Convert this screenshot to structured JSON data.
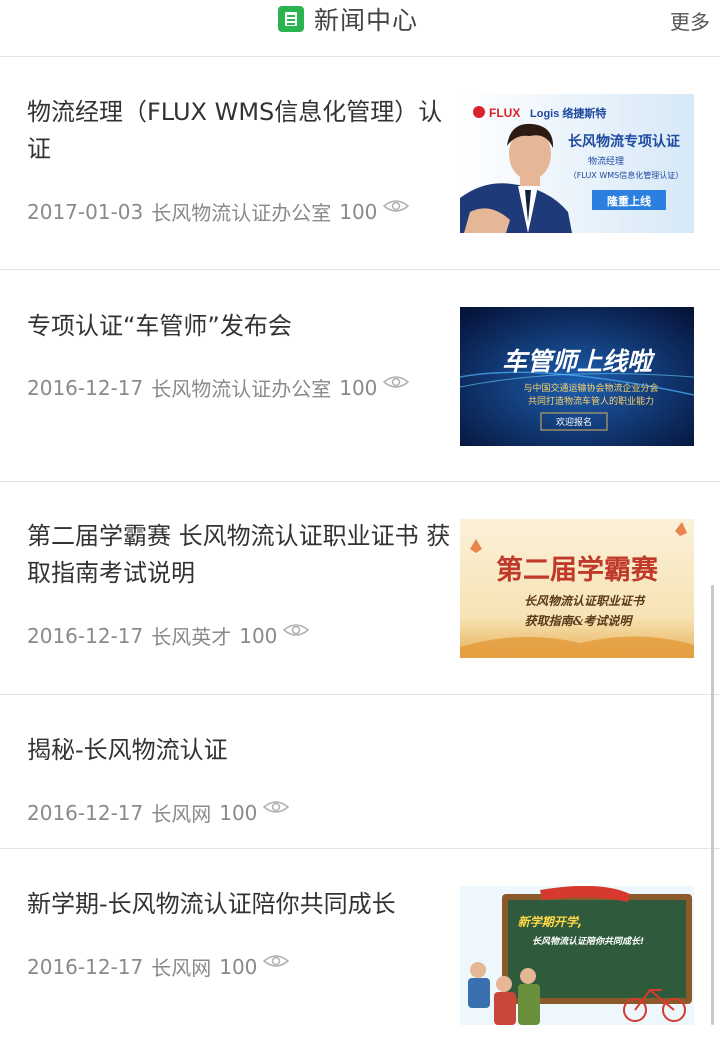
{
  "header": {
    "title": "新闻中心",
    "more_label": "更多"
  },
  "items": [
    {
      "title_line1": "物流经理（FLUX WMS信息化管理）认",
      "title_line2": "证",
      "date": "2017-01-03",
      "source": "长风物流认证办公室",
      "views": "100",
      "thumb": {
        "brand": "FLUX",
        "brand2": "Logis 络捷斯特",
        "heading": "长风物流专项认证",
        "sub1": "物流经理",
        "sub2": "（FLUX WMS信息化管理认证）",
        "badge": "隆重上线"
      }
    },
    {
      "title_line1": "专项认证“车管师”发布会",
      "title_line2": "",
      "date": "2016-12-17",
      "source": "长风物流认证办公室",
      "views": "100",
      "thumb": {
        "heading": "车管师上线啦",
        "sub1": "与中国交通运输协会物流企业分会",
        "sub2": "共同打造物流车管人的职业能力",
        "badge": "欢迎报名"
      }
    },
    {
      "title_line1": "第二届学霸赛 长风物流认证职业证书 获",
      "title_line2": "取指南考试说明",
      "date": "2016-12-17",
      "source": "长风英才",
      "views": "100",
      "thumb": {
        "heading": "第二届学霸赛",
        "sub1": "长风物流认证职业证书",
        "sub2": "获取指南&考试说明"
      }
    },
    {
      "title_line1": "揭秘-长风物流认证",
      "title_line2": "",
      "date": "2016-12-17",
      "source": "长风网",
      "views": "100"
    },
    {
      "title_line1": "新学期-长风物流认证陪你共同成长",
      "title_line2": "",
      "date": "2016-12-17",
      "source": "长风网",
      "views": "100",
      "thumb": {
        "heading": "新学期开学,",
        "sub1": "长风物流认证陪你共同成长!"
      }
    }
  ],
  "colors": {
    "accent": "#2bb34f",
    "meta": "#8a8a8a",
    "divider": "#e2e2e2"
  }
}
